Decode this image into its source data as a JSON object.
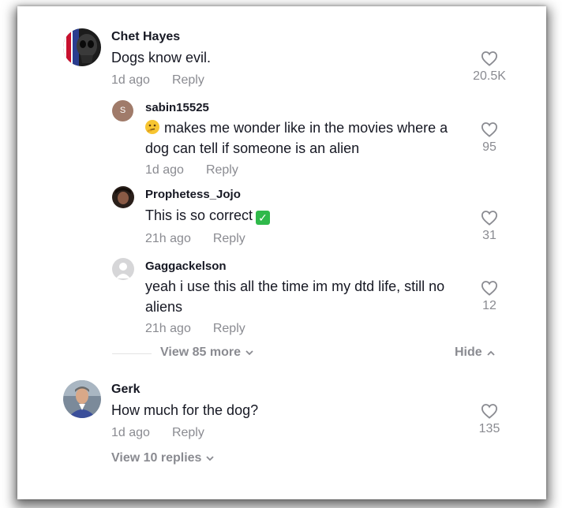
{
  "comments": [
    {
      "username": "Chet Hayes",
      "text": "Dogs know evil.",
      "time": "1d ago",
      "reply_label": "Reply",
      "likes": "20.5K",
      "replies": [
        {
          "username": "sabin15525",
          "avatar_letter": "S",
          "emoji": "thinking-face",
          "text": "makes me wonder like in the movies where a dog can tell if someone is an alien",
          "time": "1d ago",
          "reply_label": "Reply",
          "likes": "95"
        },
        {
          "username": "Prophetess_Jojo",
          "text": "This is so correct",
          "emoji": "check-mark",
          "time": "21h ago",
          "reply_label": "Reply",
          "likes": "31"
        },
        {
          "username": "Gaggackelson",
          "text": "yeah i use this all the time im my dtd life, still no aliens",
          "time": "21h ago",
          "reply_label": "Reply",
          "likes": "12"
        }
      ],
      "view_more": "View 85 more",
      "hide": "Hide"
    },
    {
      "username": "Gerk",
      "text": "How much for the dog?",
      "time": "1d ago",
      "reply_label": "Reply",
      "likes": "135",
      "view_replies": "View 10 replies"
    }
  ],
  "icons": {
    "like": "heart-outline-icon",
    "expand": "chevron-down-icon",
    "collapse": "chevron-up-icon"
  },
  "colors": {
    "text": "#161823",
    "muted": "#8a8b91",
    "sabin_avatar": "#a07b6a",
    "check_emoji": "#2fb94a"
  }
}
